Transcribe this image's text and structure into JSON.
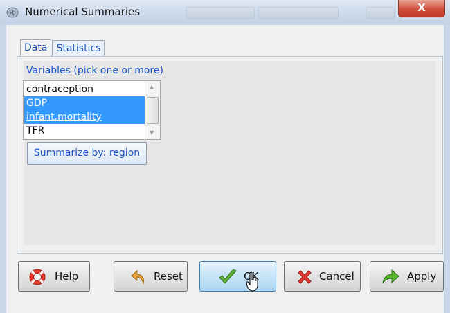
{
  "window": {
    "title": "Numerical Summaries",
    "close_label": "X"
  },
  "tabs": [
    {
      "label": "Data",
      "active": true
    },
    {
      "label": "Statistics",
      "active": false
    }
  ],
  "variables": {
    "label": "Variables (pick one or more)",
    "items": [
      {
        "label": "contraception",
        "selected": false
      },
      {
        "label": "GDP",
        "selected": true
      },
      {
        "label": "infant.mortality",
        "selected": true
      },
      {
        "label": "TFR",
        "selected": false
      }
    ]
  },
  "summarize_button": "Summarize by: region",
  "buttons": {
    "help": "Help",
    "reset": "Reset",
    "ok": "OK",
    "cancel": "Cancel",
    "apply": "Apply"
  },
  "colors": {
    "selection": "#3399ff",
    "label_blue": "#1a55c8"
  }
}
